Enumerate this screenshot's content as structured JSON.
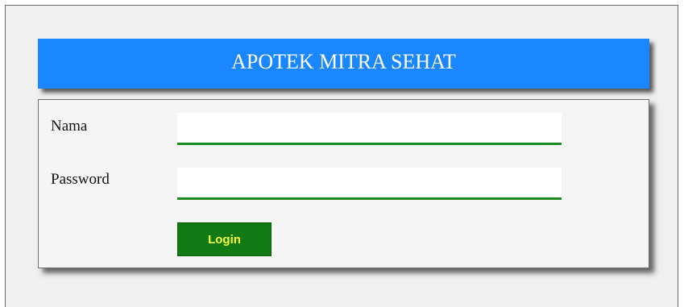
{
  "header": {
    "title": "APOTEK MITRA SEHAT"
  },
  "form": {
    "nama_label": "Nama",
    "nama_value": "",
    "password_label": "Password",
    "password_value": "",
    "login_label": "Login"
  },
  "colors": {
    "header_bg": "#1a86ff",
    "field_underline": "#1d8a1d",
    "button_bg": "#137a13",
    "button_text": "#f2ff3a"
  }
}
